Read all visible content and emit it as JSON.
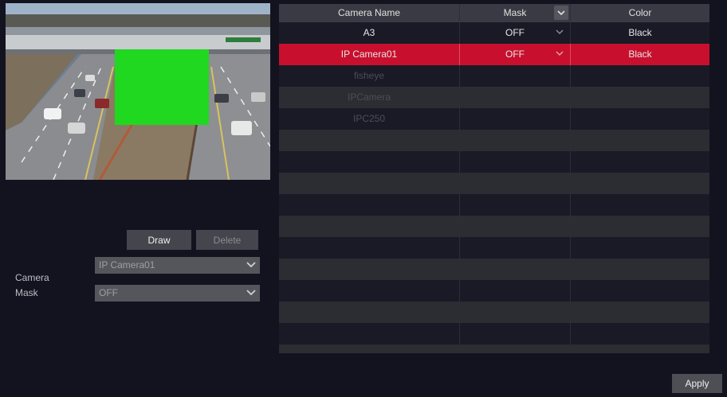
{
  "preview": {
    "mask_color": "#1fd81f"
  },
  "buttons": {
    "draw": "Draw",
    "delete": "Delete",
    "apply": "Apply"
  },
  "form": {
    "camera_label": "Camera",
    "camera_value": "IP Camera01",
    "mask_label": "Mask",
    "mask_value": "OFF"
  },
  "table": {
    "headers": {
      "name": "Camera Name",
      "mask": "Mask",
      "color": "Color"
    },
    "rows": [
      {
        "name": "A3",
        "mask": "OFF",
        "color": "Black",
        "state": "normal"
      },
      {
        "name": "IP Camera01",
        "mask": "OFF",
        "color": "Black",
        "state": "selected"
      },
      {
        "name": "fisheye",
        "mask": "",
        "color": "",
        "state": "disabled"
      },
      {
        "name": "IPCamera",
        "mask": "",
        "color": "",
        "state": "disabled"
      },
      {
        "name": "IPC250",
        "mask": "",
        "color": "",
        "state": "disabled"
      }
    ]
  },
  "colors": {
    "selected_row": "#c8102e",
    "background": "#131320"
  }
}
